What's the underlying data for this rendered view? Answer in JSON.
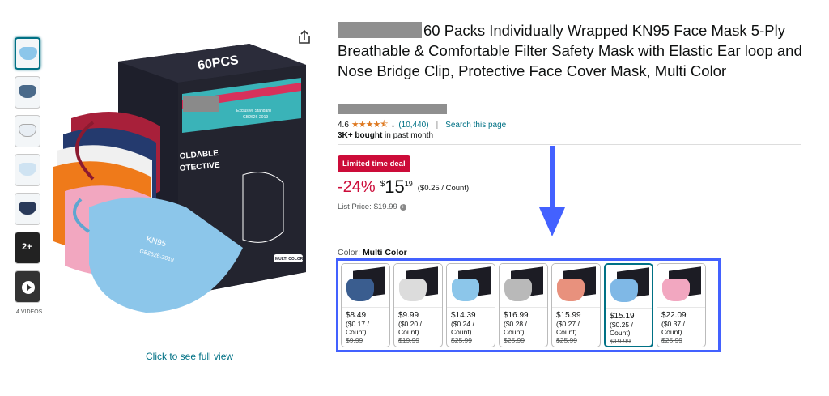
{
  "thumbnails": {
    "videos_label": "4 VIDEOS",
    "badge_2plus": "2+"
  },
  "main_image": {
    "box_text": "60PCS",
    "box_side_line1": "OLDABLE",
    "box_side_line2": "OTECTIVE",
    "box_standard": "Exclusive Standard",
    "box_standard_code": "GB2626-2019",
    "mask_text": "KN95",
    "mask_code": "GB2626-2019",
    "multi_color_tag": "MULTI COLOR",
    "see_full_view": "Click to see full view"
  },
  "product": {
    "title": "60 Packs Individually Wrapped KN95 Face Mask 5-Ply Breathable & Comfortable Filter Safety Mask with Elastic Ear loop and Nose Bridge Clip, Protective Face Cover Mask, Multi Color",
    "rating_value": "4.6",
    "stars": "★★★★⯪",
    "rating_count": "(10,440)",
    "search_page": "Search this page",
    "bought_bold": "3K+ bought",
    "bought_rest": " in past month"
  },
  "pricing": {
    "deal_badge": "Limited time deal",
    "discount": "-24%",
    "currency": "$",
    "whole": "15",
    "fraction": "19",
    "per_unit": "($0.25 / Count)",
    "list_label": "List Price:",
    "list_value": "$19.99"
  },
  "color": {
    "label": "Color:",
    "selected": "Multi Color",
    "swatches": [
      {
        "price": "$8.49",
        "per": "($0.17 /",
        "per2": "Count)",
        "old": "$9.99",
        "mask_color": "#3a5d8f",
        "selected": false
      },
      {
        "price": "$9.99",
        "per": "($0.20 /",
        "per2": "Count)",
        "old": "$19.99",
        "mask_color": "#dcdcdc",
        "selected": false
      },
      {
        "price": "$14.39",
        "per": "($0.24 /",
        "per2": "Count)",
        "old": "$25.99",
        "mask_color": "#8cc6ea",
        "selected": false
      },
      {
        "price": "$16.99",
        "per": "($0.28 /",
        "per2": "Count)",
        "old": "$25.99",
        "mask_color": "#b9b9b9",
        "selected": false
      },
      {
        "price": "$15.99",
        "per": "($0.27 /",
        "per2": "Count)",
        "old": "$25.99",
        "mask_color": "#e8917d",
        "selected": false
      },
      {
        "price": "$15.19",
        "per": "($0.25 /",
        "per2": "Count)",
        "old": "$19.99",
        "mask_color": "#7fb8e6",
        "selected": true
      },
      {
        "price": "$22.09",
        "per": "($0.37 /",
        "per2": "Count)",
        "old": "$25.99",
        "mask_color": "#f2a7c0",
        "selected": false
      }
    ]
  },
  "colors": {
    "link": "#007185",
    "deal_red": "#cc0c39",
    "highlight_blue": "#4361ff",
    "star_orange": "#de7921"
  }
}
